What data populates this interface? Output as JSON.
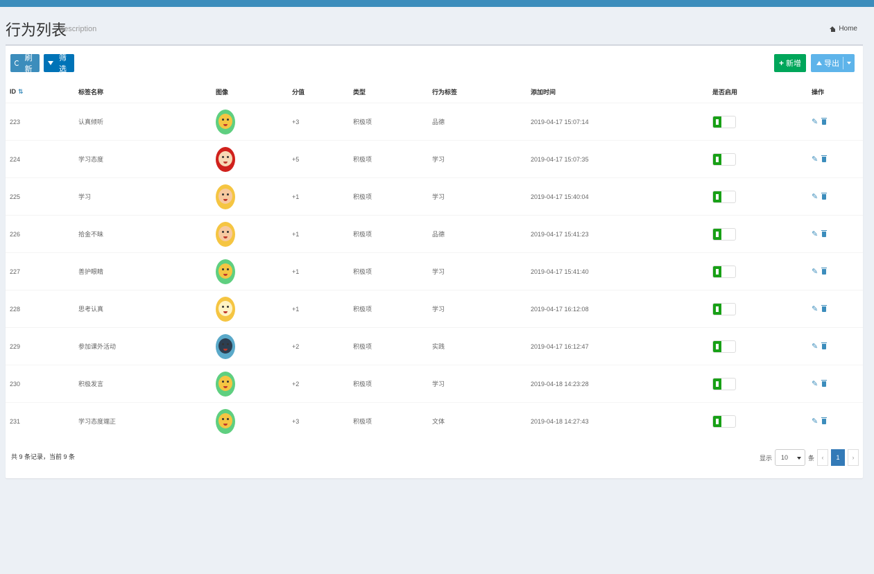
{
  "header": {
    "title": "行为列表",
    "description": "description",
    "breadcrumb": "Home"
  },
  "colors": {
    "topbar": "#3c8dbc",
    "add_button": "#00a65a",
    "switch_on": "#18a016"
  },
  "toolbar": {
    "refresh_label": "刷新",
    "filter_label": "筛选",
    "add_label": "新增",
    "export_label": "导出"
  },
  "table": {
    "columns": [
      "ID",
      "标签名称",
      "图像",
      "分值",
      "类型",
      "行为标签",
      "添加时间",
      "是否启用",
      "操作"
    ],
    "rows": [
      {
        "id": "223",
        "name": "认真倾听",
        "score": "+3",
        "type": "积极项",
        "tag": "品德",
        "time": "2019-04-17 15:07:14",
        "avatar": "green-face-icon"
      },
      {
        "id": "224",
        "name": "学习态度",
        "score": "+5",
        "type": "积极项",
        "tag": "学习",
        "time": "2019-04-17 15:07:35",
        "avatar": "red-face-icon"
      },
      {
        "id": "225",
        "name": "学习",
        "score": "+1",
        "type": "积极项",
        "tag": "学习",
        "time": "2019-04-17 15:40:04",
        "avatar": "yellow-face-icon"
      },
      {
        "id": "226",
        "name": "拾金不昧",
        "score": "+1",
        "type": "积极项",
        "tag": "品德",
        "time": "2019-04-17 15:41:23",
        "avatar": "yellow-face-icon"
      },
      {
        "id": "227",
        "name": "善护眼睛",
        "score": "+1",
        "type": "积极项",
        "tag": "学习",
        "time": "2019-04-17 15:41:40",
        "avatar": "green-face-icon"
      },
      {
        "id": "228",
        "name": "思考认真",
        "score": "+1",
        "type": "积极项",
        "tag": "学习",
        "time": "2019-04-17 16:12:08",
        "avatar": "magnifier-face-icon"
      },
      {
        "id": "229",
        "name": "参加课外活动",
        "score": "+2",
        "type": "积极项",
        "tag": "实践",
        "time": "2019-04-17 16:12:47",
        "avatar": "graduate-face-icon"
      },
      {
        "id": "230",
        "name": "积极发言",
        "score": "+2",
        "type": "积极项",
        "tag": "学习",
        "time": "2019-04-18 14:23:28",
        "avatar": "green-face-icon"
      },
      {
        "id": "231",
        "name": "学习态度端正",
        "score": "+3",
        "type": "积极项",
        "tag": "文体",
        "time": "2019-04-18 14:27:43",
        "avatar": "green-face-icon"
      }
    ]
  },
  "footer": {
    "info": "共 9 条记录，当前 9 条",
    "page_size_prefix": "显示",
    "page_size": "10",
    "page_size_suffix": "条",
    "prev": "‹",
    "current_page": "1",
    "next": "›"
  }
}
